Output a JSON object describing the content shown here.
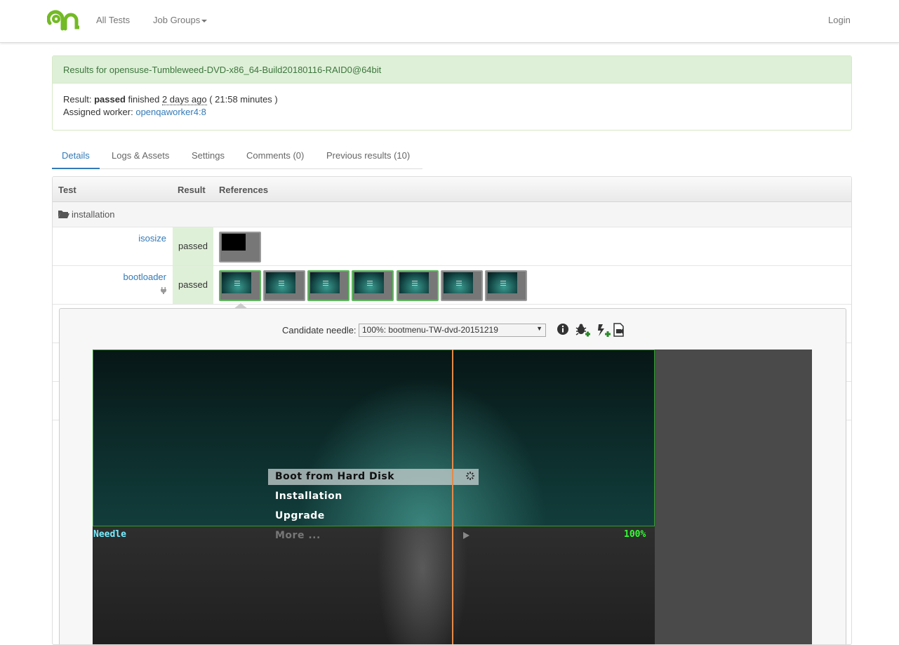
{
  "nav": {
    "all_tests": "All Tests",
    "job_groups": "Job Groups",
    "login": "Login"
  },
  "result_panel": {
    "heading": "Results for opensuse-Tumbleweed-DVD-x86_64-Build20180116-RAID0@64bit",
    "result_label": "Result:",
    "result_value": "passed",
    "finished_label": "finished",
    "finished_ago": "2 days ago",
    "duration": "( 21:58 minutes )",
    "worker_label": "Assigned worker:",
    "worker": "openqaworker4:8"
  },
  "tabs": [
    {
      "label": "Details",
      "active": true
    },
    {
      "label": "Logs & Assets"
    },
    {
      "label": "Settings"
    },
    {
      "label": "Comments (0)"
    },
    {
      "label": "Previous results (10)"
    }
  ],
  "table": {
    "headers": [
      "Test",
      "Result",
      "References"
    ],
    "category": "installation",
    "rows": [
      {
        "name": "isosize",
        "result": "passed",
        "thumbnails": [
          {
            "kind": "black",
            "match": false
          }
        ]
      },
      {
        "name": "bootloader",
        "result": "passed",
        "thumbnails": [
          {
            "match": true
          },
          {
            "match": false
          },
          {
            "match": true
          },
          {
            "match": true
          },
          {
            "match": true
          },
          {
            "match": false
          },
          {
            "match": false
          }
        ]
      }
    ]
  },
  "viewer": {
    "candidate_label": "Candidate needle:",
    "candidate_value": "100%: bootmenu-TW-dvd-20151219",
    "menu_items": [
      "Boot from Hard Disk",
      "Installation",
      "Upgrade",
      "More ..."
    ],
    "needle_label": "Needle",
    "match_percent": "100%",
    "icons": [
      "info-icon",
      "new-bug-icon",
      "new-needle-icon",
      "needle-file-icon"
    ]
  },
  "colors": {
    "success_bg": "#dff0d8",
    "link": "#337ab7",
    "needle_box": "#2ca02c",
    "divider": "#e48a4a"
  }
}
